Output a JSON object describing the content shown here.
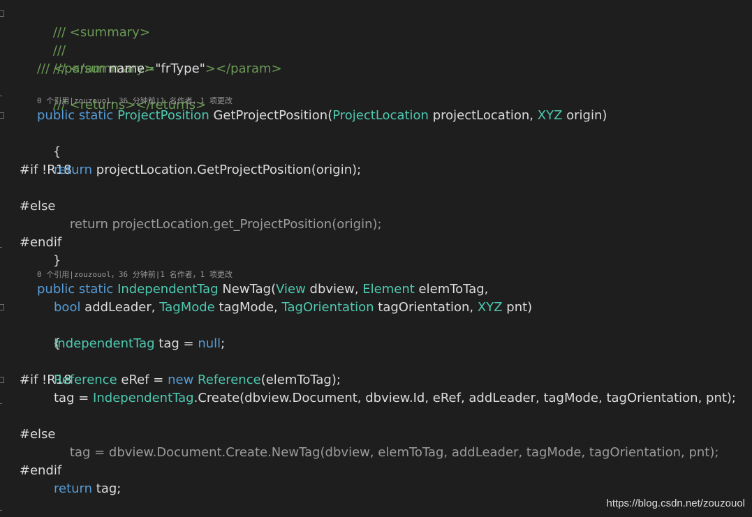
{
  "code": {
    "doc": {
      "summary_open": "/// <summary>",
      "blank": "///",
      "summary_close": "/// </summary>",
      "param_prefix": "/// <param ",
      "param_attr": "name",
      "param_eq": "=",
      "param_value": "\"frType\"",
      "param_close": "></param>",
      "returns": "/// <returns></returns>"
    },
    "codelens": [
      "0 个引用|zouzouol，36 分钟前|1 名作者，1 项更改",
      "0 个引用|zouzouol，36 分钟前|1 名作者，1 项更改"
    ],
    "method1": {
      "public": "public",
      "static": "static",
      "return_type": "ProjectPosition",
      "name": "GetProjectPosition(",
      "param1_type": "ProjectLocation",
      "param1_name": " projectLocation, ",
      "param2_type": "XYZ",
      "param2_name": " origin)",
      "open_brace": "{",
      "if_directive": "#if !R18",
      "return_kw": "return",
      "return_expr": " projectLocation.GetProjectPosition(origin);",
      "else_directive": "#else",
      "inactive_line": "return projectLocation.get_ProjectPosition(origin);",
      "endif_directive": "#endif",
      "close_brace": "}"
    },
    "method2": {
      "public": "public",
      "static": "static",
      "return_type": "IndependentTag",
      "name": " NewTag(",
      "p1_type": "View",
      "p1_name": " dbview, ",
      "p2_type": "Element",
      "p2_name": " elemToTag,",
      "p3_type": "bool",
      "p3_name": " addLeader, ",
      "p4_type": "TagMode",
      "p4_name": " tagMode, ",
      "p5_type": "TagOrientation",
      "p5_name": " tagOrientation, ",
      "p6_type": "XYZ",
      "p6_name": " pnt)",
      "open_brace": "{",
      "decl_type": "IndependentTag",
      "decl_mid": " tag = ",
      "decl_null": "null",
      "decl_end": ";",
      "if_directive": "#if !R18",
      "ref_type": "Reference",
      "ref_mid": " eRef = ",
      "ref_new": "new",
      "ref_type2": "Reference",
      "ref_end": "(elemToTag);",
      "assign_start": "tag = ",
      "assign_type": "IndependentTag",
      "assign_end": ".Create(dbview.Document, dbview.Id, eRef, addLeader, tagMode, tagOrientation, pnt);",
      "else_directive": "#else",
      "inactive_line": "tag = dbview.Document.Create.NewTag(dbview, elemToTag, addLeader, tagMode, tagOrientation, pnt);",
      "endif_directive": "#endif",
      "return_kw": "return",
      "return_expr": " tag;",
      "close_brace": "}"
    }
  },
  "watermark": "https://blog.csdn.net/zouzouol",
  "colors": {
    "background": "#1e1e1e",
    "keyword": "#569cd6",
    "type": "#4ec9b0",
    "comment": "#57a64a",
    "text": "#dcdcdc",
    "inactive": "#9b9b9b"
  }
}
